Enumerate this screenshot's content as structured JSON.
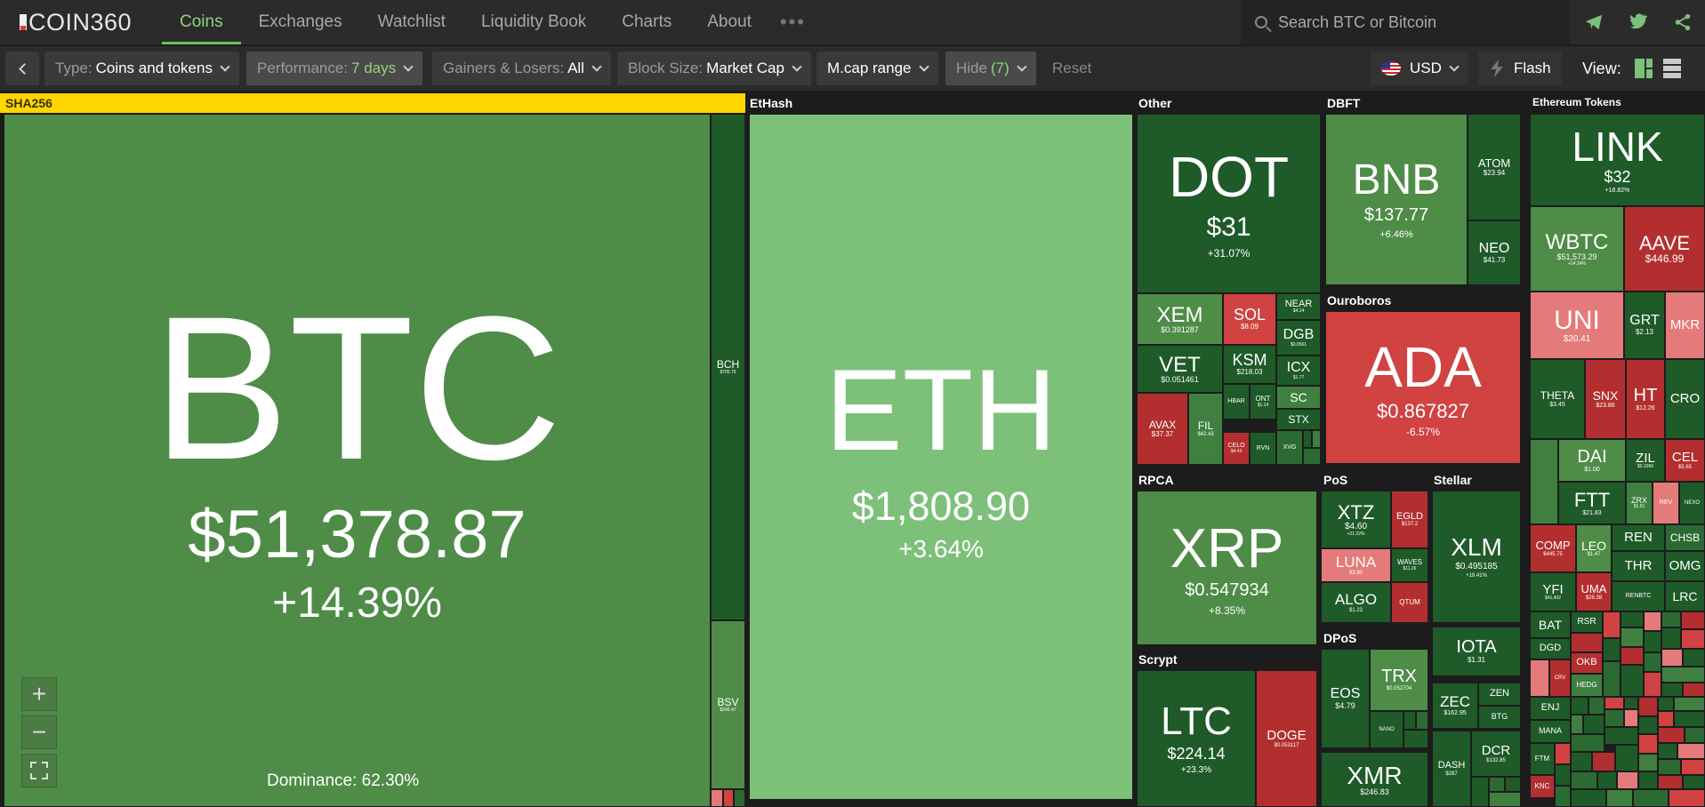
{
  "app": {
    "logo": "COIN360"
  },
  "nav": {
    "tabs": [
      "Coins",
      "Exchanges",
      "Watchlist",
      "Liquidity Book",
      "Charts",
      "About"
    ],
    "more": "•••"
  },
  "search": {
    "placeholder": "Search BTC or Bitcoin"
  },
  "filters": {
    "type_label": "Type:",
    "type_value": "Coins and tokens",
    "perf_label": "Performance:",
    "perf_value": "7 days",
    "gl_label": "Gainers & Losers:",
    "gl_value": "All",
    "block_label": "Block Size:",
    "block_value": "Market Cap",
    "mcap": "M.cap range",
    "hide_label": "Hide",
    "hide_value": "(7)",
    "reset": "Reset",
    "currency": "USD",
    "flash": "Flash",
    "view": "View:"
  },
  "colors": {
    "accent": "#6ac35a",
    "gain_strong": "#7dc07a",
    "gain": "#4e8c47",
    "loss": "#d14242",
    "sha_bar": "#ffd600"
  },
  "groups": {
    "sha256": "SHA256",
    "ethash": "EtHash",
    "other": "Other",
    "dbft": "DBFT",
    "eth_tokens": "Ethereum Tokens",
    "ouroboros": "Ouroboros",
    "rpca": "RPCA",
    "pos": "PoS",
    "stellar": "Stellar",
    "dpos": "DPoS",
    "scrypt": "Scrypt"
  },
  "dominance": "Dominance: 62.30%",
  "zoom": {
    "in": "+",
    "out": "−"
  },
  "tiles": {
    "btc": {
      "sym": "BTC",
      "price": "$51,378.87",
      "chg": "+14.39%"
    },
    "bch": {
      "sym": "BCH",
      "price": "$706.75"
    },
    "bsv": {
      "sym": "BSV",
      "price": "$246.47"
    },
    "eth": {
      "sym": "ETH",
      "price": "$1,808.90",
      "chg": "+3.64%"
    },
    "dot": {
      "sym": "DOT",
      "price": "$31",
      "chg": "+31.07%"
    },
    "bnb": {
      "sym": "BNB",
      "price": "$137.77",
      "chg": "+6.46%"
    },
    "atom": {
      "sym": "ATOM",
      "price": "$23.94"
    },
    "neo": {
      "sym": "NEO",
      "price": "$41.73"
    },
    "xem": {
      "sym": "XEM",
      "price": "$0.391287"
    },
    "sol": {
      "sym": "SOL",
      "price": "$8.09"
    },
    "near": {
      "sym": "NEAR",
      "price": "$4.14"
    },
    "dgb": {
      "sym": "DGB",
      "price": "$0.0561"
    },
    "vet": {
      "sym": "VET",
      "price": "$0.051461"
    },
    "ksm": {
      "sym": "KSM",
      "price": "$218.03"
    },
    "icx": {
      "sym": "ICX",
      "price": "$1.77"
    },
    "hbar": {
      "sym": "HBAR"
    },
    "ont": {
      "sym": "ONT",
      "price": "$1.14"
    },
    "sc": {
      "sym": "SC"
    },
    "stx": {
      "sym": "STX"
    },
    "avax": {
      "sym": "AVAX",
      "price": "$37.37"
    },
    "fil": {
      "sym": "FIL",
      "price": "$42.43"
    },
    "celo": {
      "sym": "CELO",
      "price": "$4.43"
    },
    "rvn": {
      "sym": "RVN"
    },
    "xvg": {
      "sym": "XVG"
    },
    "ada": {
      "sym": "ADA",
      "price": "$0.867827",
      "chg": "-6.57%"
    },
    "xrp": {
      "sym": "XRP",
      "price": "$0.547934",
      "chg": "+8.35%"
    },
    "xtz": {
      "sym": "XTZ",
      "price": "$4.60",
      "chg": "+21.22%"
    },
    "egld": {
      "sym": "EGLD",
      "price": "$137.2"
    },
    "luna": {
      "sym": "LUNA",
      "price": "$3.90"
    },
    "waves": {
      "sym": "WAVES",
      "price": "$11.26"
    },
    "qtum": {
      "sym": "QTUM"
    },
    "algo": {
      "sym": "ALGO",
      "price": "$1.23"
    },
    "xlm": {
      "sym": "XLM",
      "price": "$0.495185",
      "chg": "+19.41%"
    },
    "iota": {
      "sym": "IOTA",
      "price": "$1.31"
    },
    "zec": {
      "sym": "ZEC",
      "price": "$162.95"
    },
    "zen": {
      "sym": "ZEN"
    },
    "btg": {
      "sym": "BTG"
    },
    "dash": {
      "sym": "DASH",
      "price": "$287"
    },
    "dcr": {
      "sym": "DCR",
      "price": "$132.85"
    },
    "eos": {
      "sym": "EOS",
      "price": "$4.79"
    },
    "trx": {
      "sym": "TRX",
      "price": "$0.052704"
    },
    "nano": {
      "sym": "NANO"
    },
    "xmr": {
      "sym": "XMR",
      "price": "$246.83"
    },
    "ltc": {
      "sym": "LTC",
      "price": "$224.14",
      "chg": "+23.3%"
    },
    "doge": {
      "sym": "DOGE",
      "price": "$0.053117"
    },
    "link": {
      "sym": "LINK",
      "price": "$32",
      "chg": "+18.82%"
    },
    "wbtc": {
      "sym": "WBTC",
      "price": "$51,573.29",
      "chg": "+14.24%"
    },
    "aave": {
      "sym": "AAVE",
      "price": "$446.99"
    },
    "uni": {
      "sym": "UNI",
      "price": "$20.41"
    },
    "grt": {
      "sym": "GRT",
      "price": "$2.13"
    },
    "mkr": {
      "sym": "MKR"
    },
    "theta": {
      "sym": "THETA",
      "price": "$3.45"
    },
    "snx": {
      "sym": "SNX",
      "price": "$23.86"
    },
    "ht": {
      "sym": "HT",
      "price": "$12.26"
    },
    "cro": {
      "sym": "CRO"
    },
    "dai": {
      "sym": "DAI",
      "price": "$1.00"
    },
    "zil": {
      "sym": "ZIL",
      "price": "$0.1066"
    },
    "cel": {
      "sym": "CEL",
      "price": "$5.65"
    },
    "ftt": {
      "sym": "FTT",
      "price": "$21.83"
    },
    "zrx": {
      "sym": "ZRX",
      "price": "$1.51"
    },
    "rev": {
      "sym": "REV"
    },
    "nexo": {
      "sym": "NEXO"
    },
    "comp": {
      "sym": "COMP",
      "price": "$445.75"
    },
    "leo": {
      "sym": "LEO",
      "price": "$1.47"
    },
    "ren": {
      "sym": "REN"
    },
    "chsb": {
      "sym": "CHSB"
    },
    "thr": {
      "sym": "THR"
    },
    "omg": {
      "sym": "OMG"
    },
    "yfi": {
      "sym": "YFI",
      "price": "$41,402"
    },
    "uma": {
      "sym": "UMA",
      "price": "$26.38"
    },
    "renbtc": {
      "sym": "RENBTC"
    },
    "lrc": {
      "sym": "LRC"
    },
    "bat": {
      "sym": "BAT"
    },
    "rsr": {
      "sym": "RSR"
    },
    "dgd": {
      "sym": "DGD"
    },
    "okb": {
      "sym": "OKB"
    },
    "crv": {
      "sym": "CRV"
    },
    "hedg": {
      "sym": "HEDG"
    },
    "enj": {
      "sym": "ENJ"
    },
    "mana": {
      "sym": "MANA"
    },
    "ftm": {
      "sym": "FTM"
    },
    "knc": {
      "sym": "KNC"
    }
  }
}
